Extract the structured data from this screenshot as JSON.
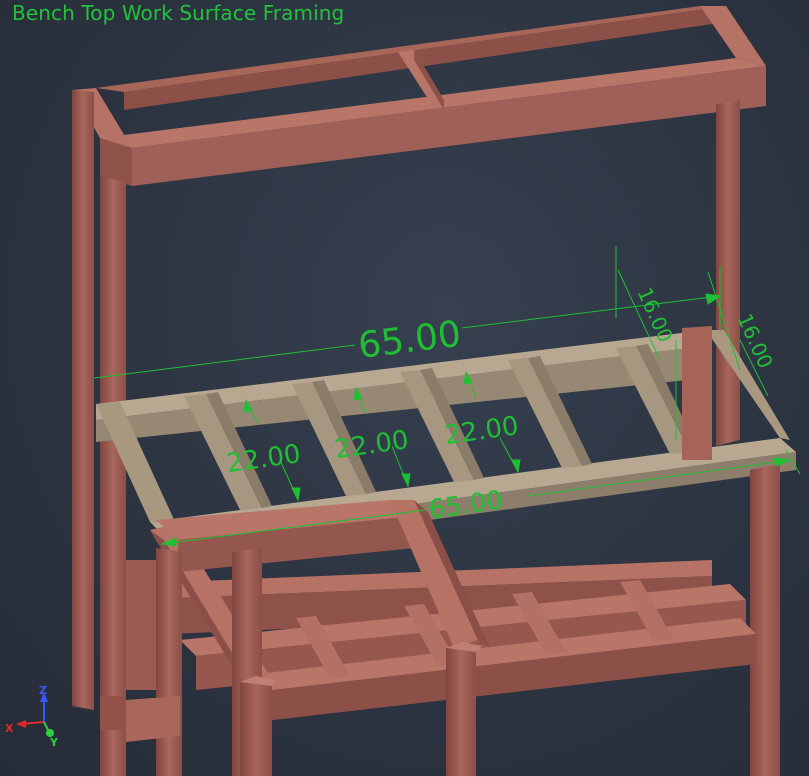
{
  "view": {
    "title": "Bench Top Work Surface Framing"
  },
  "dimensions": {
    "top_overall": "65.00",
    "front_overall": "65.00",
    "spacing_1": "22.00",
    "spacing_2": "22.00",
    "spacing_3": "22.00",
    "depth_left": "16.00",
    "depth_right": "16.00"
  },
  "triad": {
    "z": "Z",
    "x": "X",
    "y": "Y"
  },
  "colors": {
    "background": "#2e3440",
    "dimension": "#1fbf33",
    "frame_red": "#9a5b52",
    "frame_tan": "#9f8f7a"
  }
}
